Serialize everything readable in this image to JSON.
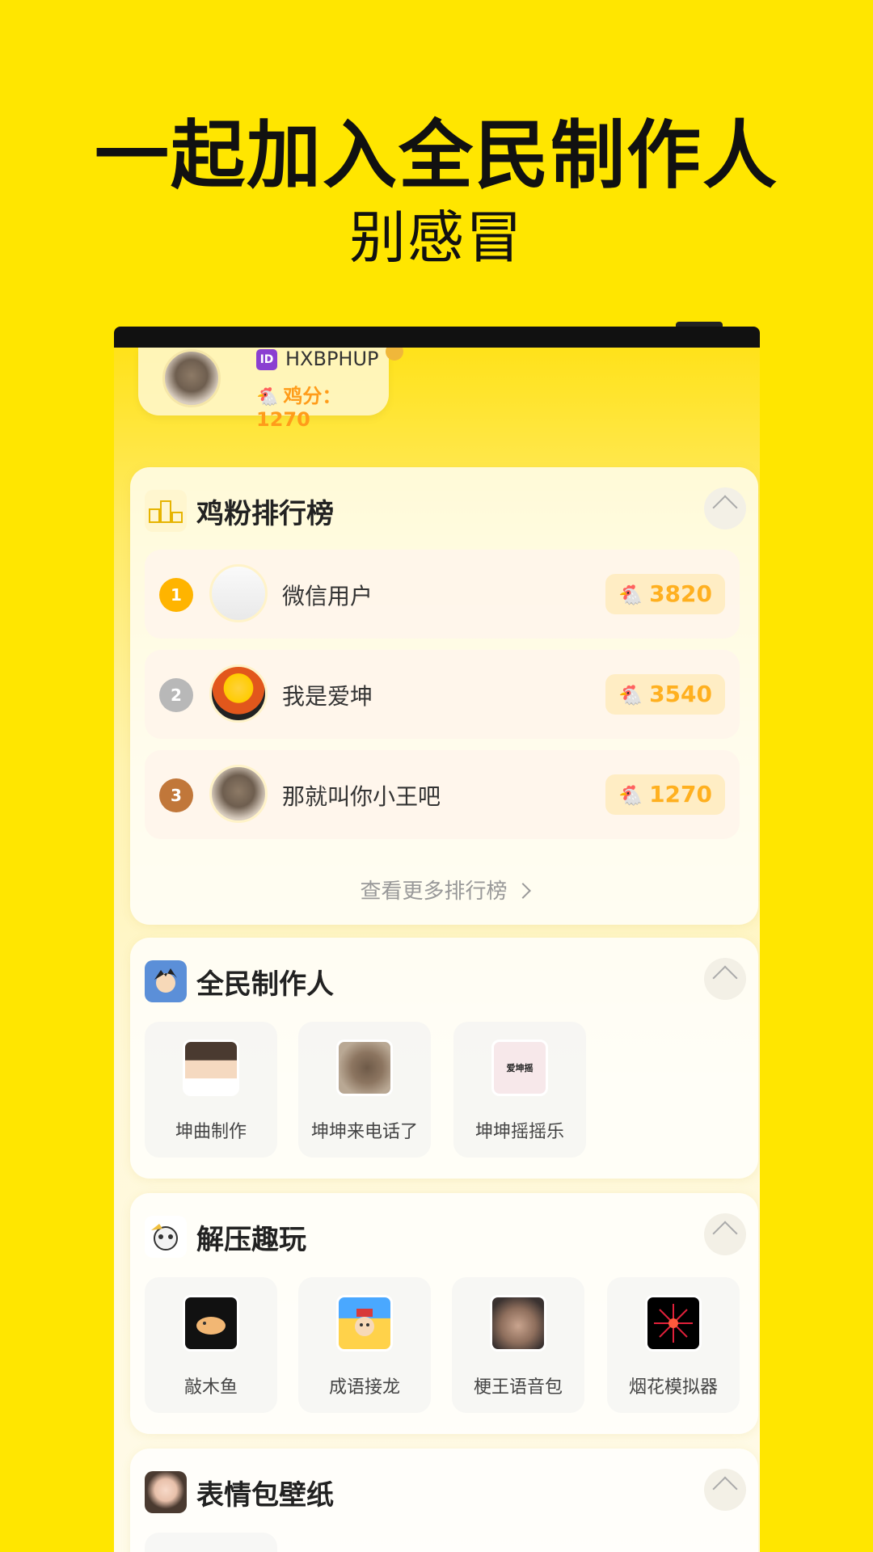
{
  "promo": {
    "headline": "一起加入全民制作人",
    "subline": "别感冒"
  },
  "user": {
    "id_badge": "ID",
    "id": "HXBPHUP",
    "chick_icon": "🐔",
    "score_label": "鸡分：1270"
  },
  "ranking": {
    "title": "鸡粉排行榜",
    "icon": "🏆",
    "items": [
      {
        "rank": "1",
        "name": "微信用户",
        "score": "3820",
        "color": "#FFB400"
      },
      {
        "rank": "2",
        "name": "我是爱坤",
        "score": "3540",
        "color": "#B8B8B8"
      },
      {
        "rank": "3",
        "name": "那就叫你小王吧",
        "score": "1270",
        "color": "#C1773A"
      }
    ],
    "more": "查看更多排行榜"
  },
  "producer": {
    "title": "全民制作人",
    "items": [
      {
        "label": "坤曲制作"
      },
      {
        "label": "坤坤来电话了"
      },
      {
        "label": "坤坤摇摇乐",
        "img_text": "爱坤摇"
      }
    ]
  },
  "relax": {
    "title": "解压趣玩",
    "items": [
      {
        "label": "敲木鱼"
      },
      {
        "label": "成语接龙"
      },
      {
        "label": "梗王语音包"
      },
      {
        "label": "烟花模拟器"
      }
    ]
  },
  "wallpaper": {
    "title": "表情包壁纸"
  },
  "colors": {
    "background": "#FFE600",
    "accent": "#FFB020"
  }
}
